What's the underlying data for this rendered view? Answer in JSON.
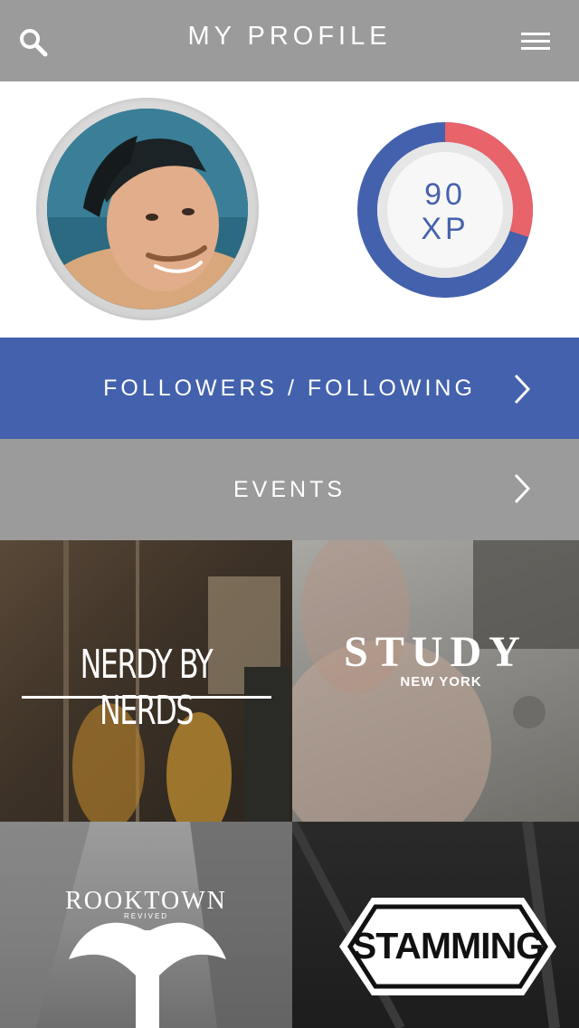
{
  "header": {
    "title": "MY PROFILE",
    "search_icon": "search-icon",
    "menu_icon": "hamburger-menu-icon"
  },
  "profile": {
    "avatar_icon": "user-avatar",
    "xp": {
      "value": "90",
      "unit": "XP",
      "progress_fraction": 0.3,
      "colors": {
        "primary": "#4461ad",
        "remaining": "#e8636a"
      }
    }
  },
  "nav": {
    "followers_label": "FOLLOWERS / FOLLOWING",
    "events_label": "EVENTS",
    "chevron_icon": "chevron-right-icon"
  },
  "brands": [
    {
      "name": "NERDY BY NERDS"
    },
    {
      "name": "STUDY",
      "subtitle": "NEW YORK"
    },
    {
      "name": "ROOKTOWN",
      "subtitle": "REVIVED"
    },
    {
      "name": "STAMMING"
    }
  ],
  "colors": {
    "header_bg": "#9b9b9b",
    "accent_blue": "#4461ad",
    "accent_red": "#e8636a",
    "events_bg": "#9b9b9b"
  }
}
